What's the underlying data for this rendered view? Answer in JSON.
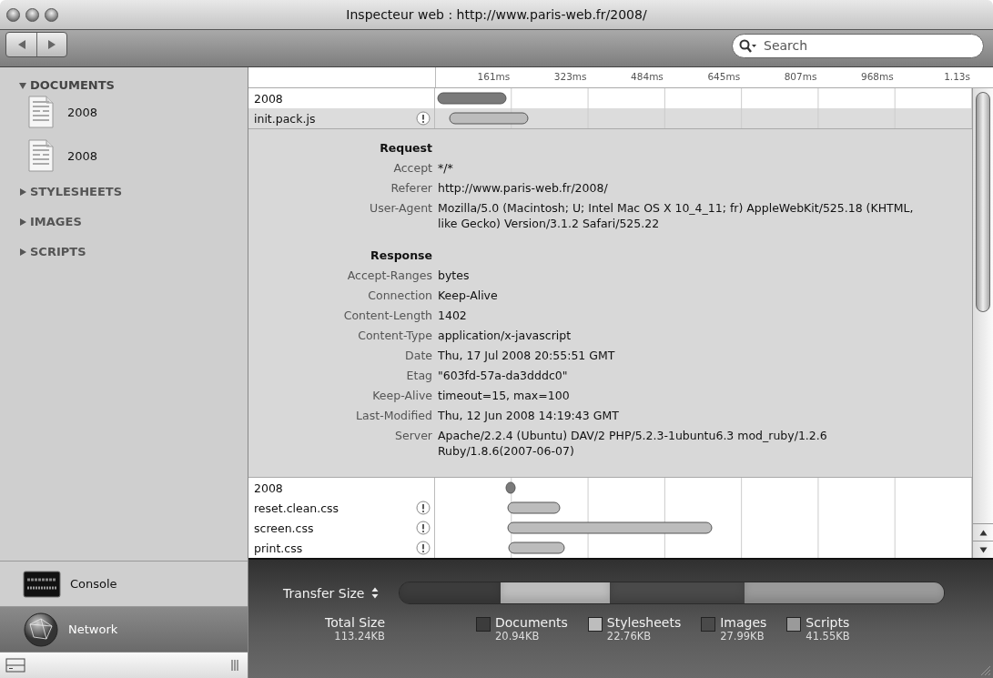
{
  "window": {
    "title": "Inspecteur web : http://www.paris-web.fr/2008/"
  },
  "toolbar": {
    "search": {
      "placeholder": "Search"
    }
  },
  "sidebar": {
    "sections": [
      {
        "label": "DOCUMENTS",
        "expanded": true,
        "items": [
          {
            "label": "2008"
          },
          {
            "label": "2008"
          }
        ]
      },
      {
        "label": "STYLESHEETS",
        "expanded": false
      },
      {
        "label": "IMAGES",
        "expanded": false
      },
      {
        "label": "SCRIPTS",
        "expanded": false
      }
    ]
  },
  "panels": [
    {
      "label": "Console",
      "kind": "console",
      "selected": false
    },
    {
      "label": "Network",
      "kind": "network",
      "selected": true
    }
  ],
  "network": {
    "ticks": [
      "161ms",
      "323ms",
      "484ms",
      "645ms",
      "807ms",
      "968ms",
      "1.13s"
    ],
    "resources": [
      {
        "name": "2008",
        "kind": "document",
        "warning": false,
        "expanded": false
      },
      {
        "name": "init.pack.js",
        "kind": "script",
        "warning": true,
        "expanded": true
      },
      {
        "name": "2008",
        "kind": "document",
        "warning": false,
        "expanded": false
      },
      {
        "name": "reset.clean.css",
        "kind": "stylesheet",
        "warning": true,
        "expanded": false
      },
      {
        "name": "screen.css",
        "kind": "stylesheet",
        "warning": true,
        "expanded": false
      },
      {
        "name": "print.css",
        "kind": "stylesheet",
        "warning": true,
        "expanded": false
      }
    ],
    "details": [
      {
        "title": "Request",
        "headers": [
          {
            "name": "Accept",
            "value": "*/*"
          },
          {
            "name": "Referer",
            "value": "http://www.paris-web.fr/2008/"
          },
          {
            "name": "User-Agent",
            "value": "Mozilla/5.0 (Macintosh; U; Intel Mac OS X 10_4_11; fr) AppleWebKit/525.18 (KHTML, like Gecko) Version/3.1.2 Safari/525.22"
          }
        ]
      },
      {
        "title": "Response",
        "headers": [
          {
            "name": "Accept-Ranges",
            "value": "bytes"
          },
          {
            "name": "Connection",
            "value": "Keep-Alive"
          },
          {
            "name": "Content-Length",
            "value": "1402"
          },
          {
            "name": "Content-Type",
            "value": "application/x-javascript"
          },
          {
            "name": "Date",
            "value": "Thu, 17 Jul 2008 20:55:51 GMT"
          },
          {
            "name": "Etag",
            "value": "\"603fd-57a-da3dddc0\""
          },
          {
            "name": "Keep-Alive",
            "value": "timeout=15, max=100"
          },
          {
            "name": "Last-Modified",
            "value": "Thu, 12 Jun 2008 14:19:43 GMT"
          },
          {
            "name": "Server",
            "value": "Apache/2.2.4 (Ubuntu) DAV/2 PHP/5.2.3-1ubuntu6.3 mod_ruby/1.2.6 Ruby/1.8.6(2007-06-07)"
          }
        ]
      }
    ]
  },
  "summary": {
    "selector": "Transfer Size",
    "total_label": "Total Size",
    "total": "113.24KB",
    "categories": [
      {
        "label": "Documents",
        "size": "20.94KB",
        "color": "#3c3c3c"
      },
      {
        "label": "Stylesheets",
        "size": "22.76KB",
        "color": "#bdbdbd"
      },
      {
        "label": "Images",
        "size": "27.99KB",
        "color": "#4a4a4a"
      },
      {
        "label": "Scripts",
        "size": "41.55KB",
        "color": "#9a9a9a"
      }
    ]
  }
}
